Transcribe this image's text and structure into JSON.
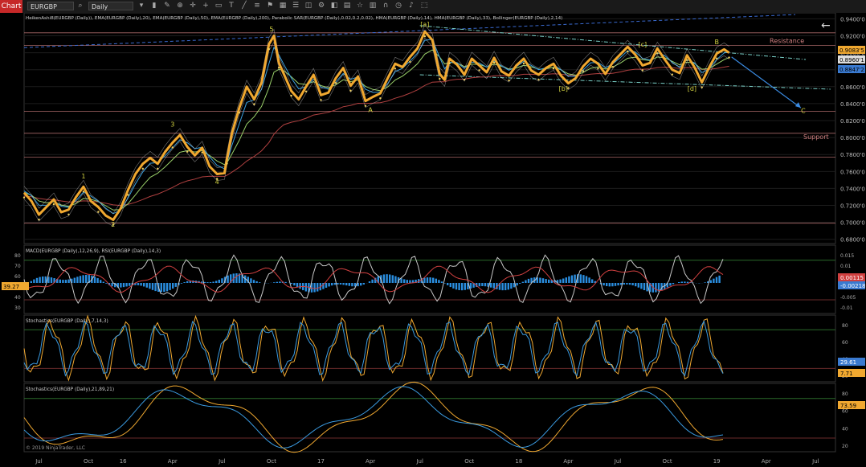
{
  "app": {
    "tab_label": "Chart",
    "instrument": "EURGBP",
    "timeframe": "Daily",
    "copyright": "© 2019 NinjaTrader, LLC"
  },
  "toolbar_icons": [
    "search-icon",
    "dropdown-icon",
    "bars-icon",
    "draw-icon",
    "zoom-icon",
    "crosshair-icon",
    "add-icon",
    "ruler-icon",
    "text-icon",
    "line-icon",
    "fib-icon",
    "flag-icon",
    "grid-icon",
    "list-icon",
    "window-icon",
    "settings-icon",
    "layers-icon",
    "calendar-icon",
    "star-icon",
    "chart-icon",
    "magnet-icon",
    "clock-icon",
    "bell-icon"
  ],
  "colors": {
    "bg": "#000000",
    "grid": "#3a1a1a",
    "price": "#f0a830",
    "ema20": "#3aa0e0",
    "ema50": "#9ad06a",
    "ema200": "#b04040",
    "bollinger": "#c8c8c8",
    "macd_hist": "#2a8ee0",
    "rsi": "#c8c8c8",
    "stoch_k": "#f0a830",
    "stoch_d": "#3a9ae0",
    "trendline": "#3a6ad0",
    "channel": "#7ad0c8",
    "wave_label": "#d0d040",
    "resistance": "#d08080",
    "support": "#d08080",
    "arrow": "#3a8ae0",
    "badge_orange": "#f0a830",
    "badge_red": "#d04040",
    "badge_blue": "#3a7ad0",
    "badge_white": "#dddddd"
  },
  "chart_data": [
    {
      "type": "line",
      "panel": "price",
      "legend": "HeikenAshi8(EURGBP (Daily)), EMA(EURGBP (Daily),20), EMA(EURGBP (Daily),50), EMA(EURGBP (Daily),200), Parabolic SAR(EURGBP (Daily),0.02,0.2,0.02), HMA(EURGBP (Daily),14), HMA(EURGBP (Daily),33), Bollinger(EURGBP (Daily),2,14)",
      "x_labels": [
        "Jul",
        "Oct",
        "16",
        "Apr",
        "Jul",
        "Oct",
        "17",
        "Apr",
        "Jul",
        "Oct",
        "18",
        "Apr",
        "Jul",
        "Oct",
        "19",
        "Apr",
        "Jul"
      ],
      "x_label_t": [
        0.3,
        1.3,
        2.0,
        3.0,
        4.0,
        5.0,
        6.0,
        7.0,
        8.0,
        9.0,
        10.0,
        11.0,
        12.0,
        13.0,
        14.0,
        15.0,
        16.0
      ],
      "xlim": [
        0,
        16.4
      ],
      "ylim": [
        0.675,
        0.947
      ],
      "yticks": [
        "0.9400'0",
        "0.9200'0",
        "0.9000'0",
        "0.8800'0",
        "0.8600'0",
        "0.8400'0",
        "0.8200'0",
        "0.8000'0",
        "0.7800'0",
        "0.7600'0",
        "0.7400'0",
        "0.7200'0",
        "0.7000'0",
        "0.6800'0"
      ],
      "ytick_values": [
        0.94,
        0.92,
        0.9,
        0.88,
        0.86,
        0.84,
        0.82,
        0.8,
        0.78,
        0.76,
        0.74,
        0.72,
        0.7,
        0.68
      ],
      "horizontal_levels": [
        0.9235,
        0.9085,
        0.831,
        0.805,
        0.777,
        0.699
      ],
      "resistance_label": "Resistance",
      "support_label": "Support",
      "series": [
        {
          "x": [
            0,
            0.15,
            0.3,
            0.45,
            0.6,
            0.75,
            0.9,
            1.05,
            1.2,
            1.35,
            1.5,
            1.65,
            1.8,
            1.95,
            2.1,
            2.25,
            2.4,
            2.55,
            2.7,
            2.85,
            3.0,
            3.15,
            3.3,
            3.45,
            3.6,
            3.75,
            3.9,
            4.05,
            4.1,
            4.2,
            4.35,
            4.5,
            4.65,
            4.8,
            4.95,
            5.05,
            5.15,
            5.25,
            5.4,
            5.55,
            5.7,
            5.85,
            6.0,
            6.15,
            6.3,
            6.45,
            6.6,
            6.75,
            6.9,
            7.05,
            7.2,
            7.35,
            7.5,
            7.65,
            7.8,
            7.95,
            8.1,
            8.25,
            8.4,
            8.5,
            8.6,
            8.75,
            8.9,
            9.05,
            9.2,
            9.35,
            9.5,
            9.65,
            9.8,
            9.95,
            10.1,
            10.25,
            10.4,
            10.55,
            10.7,
            10.85,
            11.0,
            11.15,
            11.3,
            11.45,
            11.6,
            11.75,
            11.9,
            12.05,
            12.2,
            12.35,
            12.5,
            12.65,
            12.8,
            12.95,
            13.1,
            13.25,
            13.4,
            13.55,
            13.7,
            13.85,
            14.0,
            14.15,
            14.25
          ],
          "values": [
            0.735,
            0.725,
            0.709,
            0.718,
            0.727,
            0.712,
            0.715,
            0.73,
            0.742,
            0.725,
            0.718,
            0.708,
            0.703,
            0.716,
            0.738,
            0.757,
            0.769,
            0.776,
            0.769,
            0.783,
            0.794,
            0.803,
            0.789,
            0.779,
            0.788,
            0.766,
            0.757,
            0.758,
            0.775,
            0.805,
            0.835,
            0.86,
            0.845,
            0.865,
            0.91,
            0.92,
            0.888,
            0.875,
            0.855,
            0.845,
            0.86,
            0.874,
            0.85,
            0.853,
            0.87,
            0.882,
            0.861,
            0.872,
            0.843,
            0.848,
            0.852,
            0.87,
            0.887,
            0.883,
            0.895,
            0.905,
            0.925,
            0.915,
            0.875,
            0.868,
            0.893,
            0.886,
            0.874,
            0.893,
            0.885,
            0.877,
            0.894,
            0.878,
            0.873,
            0.885,
            0.893,
            0.879,
            0.874,
            0.882,
            0.887,
            0.873,
            0.864,
            0.87,
            0.884,
            0.893,
            0.887,
            0.875,
            0.889,
            0.898,
            0.907,
            0.898,
            0.885,
            0.888,
            0.905,
            0.892,
            0.88,
            0.876,
            0.897,
            0.883,
            0.865,
            0.883,
            0.899,
            0.904,
            0.9
          ]
        }
      ],
      "last_values": [
        "0.9083'5",
        "0.8960'1",
        "0.8847'2"
      ],
      "wave_labels": [
        {
          "text": "1",
          "t": 1.2,
          "v": 0.752
        },
        {
          "text": "2",
          "t": 1.8,
          "v": 0.695
        },
        {
          "text": "3",
          "t": 3.0,
          "v": 0.813
        },
        {
          "text": "4",
          "t": 3.9,
          "v": 0.745
        },
        {
          "text": "5",
          "t": 5.0,
          "v": 0.925
        },
        {
          "text": "A",
          "t": 7.0,
          "v": 0.83
        },
        {
          "text": "[a]",
          "t": 8.1,
          "v": 0.931
        },
        {
          "text": "[b]",
          "t": 10.9,
          "v": 0.855
        },
        {
          "text": "[c]",
          "t": 12.5,
          "v": 0.907
        },
        {
          "text": "[d]",
          "t": 13.5,
          "v": 0.855
        },
        {
          "text": "B",
          "t": 14.0,
          "v": 0.91
        },
        {
          "text": "C",
          "t": 15.75,
          "v": 0.829
        }
      ]
    },
    {
      "type": "line",
      "panel": "macd_rsi",
      "legend": "MACD(EURGBP (Daily),12,26,9), RSI(EURGBP (Daily),14,3)",
      "yticks_left": [
        "80",
        "70",
        "60",
        "50",
        "40",
        "30"
      ],
      "yticks_right": [
        "0.015",
        "0.01",
        "0.005",
        "0",
        "-0.005",
        "-0.01"
      ],
      "last_values": [
        "0.00115",
        "-0.00218",
        "39.27"
      ]
    },
    {
      "type": "line",
      "panel": "stoch_fast",
      "legend": "Stochastics(EURGBP (Daily),7,14,3)",
      "yticks": [
        "80",
        "60",
        "40",
        "20"
      ],
      "last_values": [
        "29.61",
        "7.71"
      ]
    },
    {
      "type": "line",
      "panel": "stoch_slow",
      "legend": "Stochastics(EURGBP (Daily),21,89,21)",
      "yticks": [
        "80",
        "60",
        "40",
        "20"
      ],
      "last_values": [
        "73.59"
      ]
    }
  ]
}
